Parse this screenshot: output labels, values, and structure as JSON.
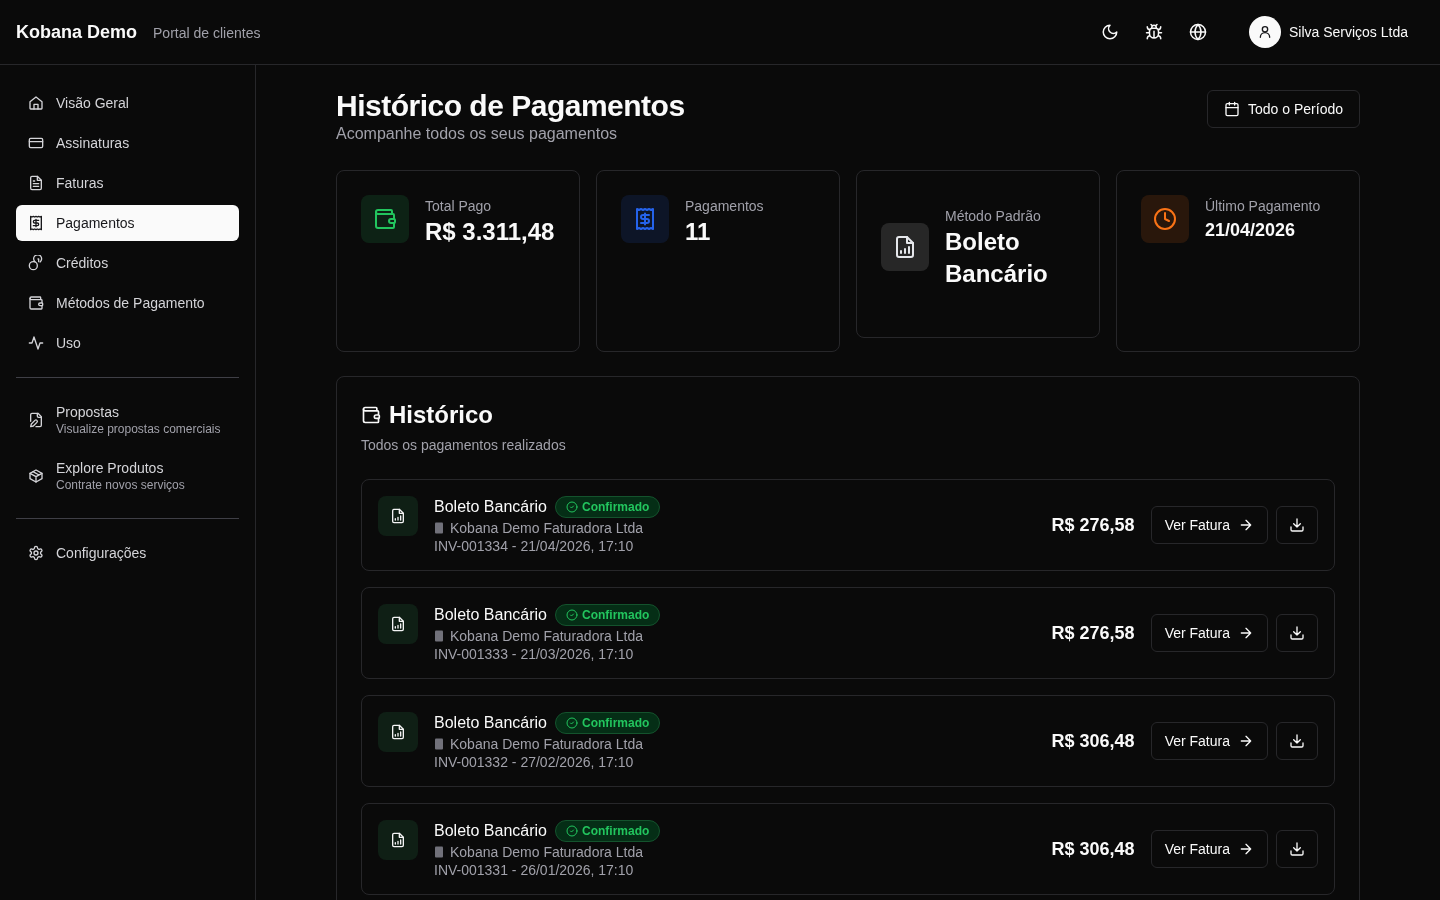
{
  "header": {
    "brand": "Kobana Demo",
    "subtitle": "Portal de clientes",
    "user": "Silva Serviços Ltda"
  },
  "sidebar": {
    "groups": [
      [
        {
          "label": "Visão Geral",
          "selected": false
        },
        {
          "label": "Assinaturas",
          "selected": false
        },
        {
          "label": "Faturas",
          "selected": false
        },
        {
          "label": "Pagamentos",
          "selected": true
        },
        {
          "label": "Créditos",
          "selected": false
        },
        {
          "label": "Métodos de Pagamento",
          "selected": false
        },
        {
          "label": "Uso",
          "selected": false
        }
      ],
      [
        {
          "label": "Propostas",
          "description": "Visualize propostas comerciais",
          "selected": false
        },
        {
          "label": "Explore Produtos",
          "description": "Contrate novos serviços",
          "selected": false
        }
      ],
      [
        {
          "label": "Configurações",
          "selected": false
        }
      ]
    ]
  },
  "page": {
    "title": "Histórico de Pagamentos",
    "subtitle": "Acompanhe todos os seus pagamentos",
    "period_button": "Todo o Período"
  },
  "stats": [
    {
      "label": "Total Pago",
      "value": "R$ 3.311,48",
      "color": "#22c55e"
    },
    {
      "label": "Pagamentos",
      "value": "11",
      "color": "#2563eb"
    },
    {
      "label": "Método Padrão",
      "value": "Boleto Bancário",
      "color": "#e5e7eb"
    },
    {
      "label": "Último Pagamento",
      "value": "21/04/2026",
      "color": "#f97316"
    }
  ],
  "history": {
    "title": "Histórico",
    "subtitle": "Todos os pagamentos realizados",
    "payments": [
      {
        "method": "Boleto Bancário",
        "status": "Confirmado",
        "company": "Kobana Demo Faturadora Ltda",
        "reference": "INV-001334 - 21/04/2026, 17:10",
        "amount": "R$ 276,58",
        "action": "Ver Fatura"
      },
      {
        "method": "Boleto Bancário",
        "status": "Confirmado",
        "company": "Kobana Demo Faturadora Ltda",
        "reference": "INV-001333 - 21/03/2026, 17:10",
        "amount": "R$ 276,58",
        "action": "Ver Fatura"
      },
      {
        "method": "Boleto Bancário",
        "status": "Confirmado",
        "company": "Kobana Demo Faturadora Ltda",
        "reference": "INV-001332 - 27/02/2026, 17:10",
        "amount": "R$ 306,48",
        "action": "Ver Fatura"
      },
      {
        "method": "Boleto Bancário",
        "status": "Confirmado",
        "company": "Kobana Demo Faturadora Ltda",
        "reference": "INV-001331 - 26/01/2026, 17:10",
        "amount": "R$ 306,48",
        "action": "Ver Fatura"
      }
    ]
  }
}
